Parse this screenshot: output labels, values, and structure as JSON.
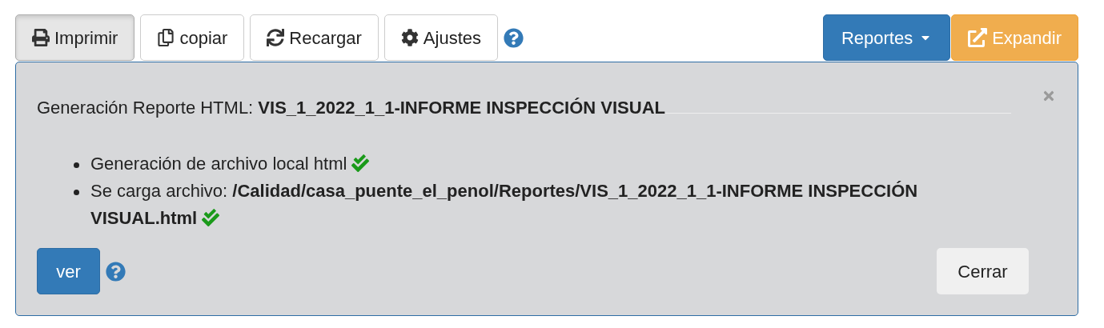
{
  "toolbar": {
    "buttons": [
      {
        "kind": "print",
        "label": "Imprimir",
        "selected": true
      },
      {
        "kind": "copy",
        "label": "copiar",
        "selected": false
      },
      {
        "kind": "reload",
        "label": "Recargar",
        "selected": false
      },
      {
        "kind": "settings",
        "label": "Ajustes",
        "selected": false
      }
    ],
    "reports_button": "Reportes",
    "expand_button": "Expandir"
  },
  "panel": {
    "title": "Generación Reporte HTML: **VIS_1_2022_1_1-INFORME INSPECCIÓN VISUAL**",
    "items": [
      {
        "text": "Generación de archivo local html",
        "done": true
      },
      {
        "text": "Se carga archivo: **/Calidad/casa_puente_el_penol/Reportes/VIS_1_2022_1_1-INFORME INSPECCIÓN VISUAL.html**",
        "done": true
      }
    ],
    "view_button": "ver",
    "close_button": "Cerrar"
  }
}
